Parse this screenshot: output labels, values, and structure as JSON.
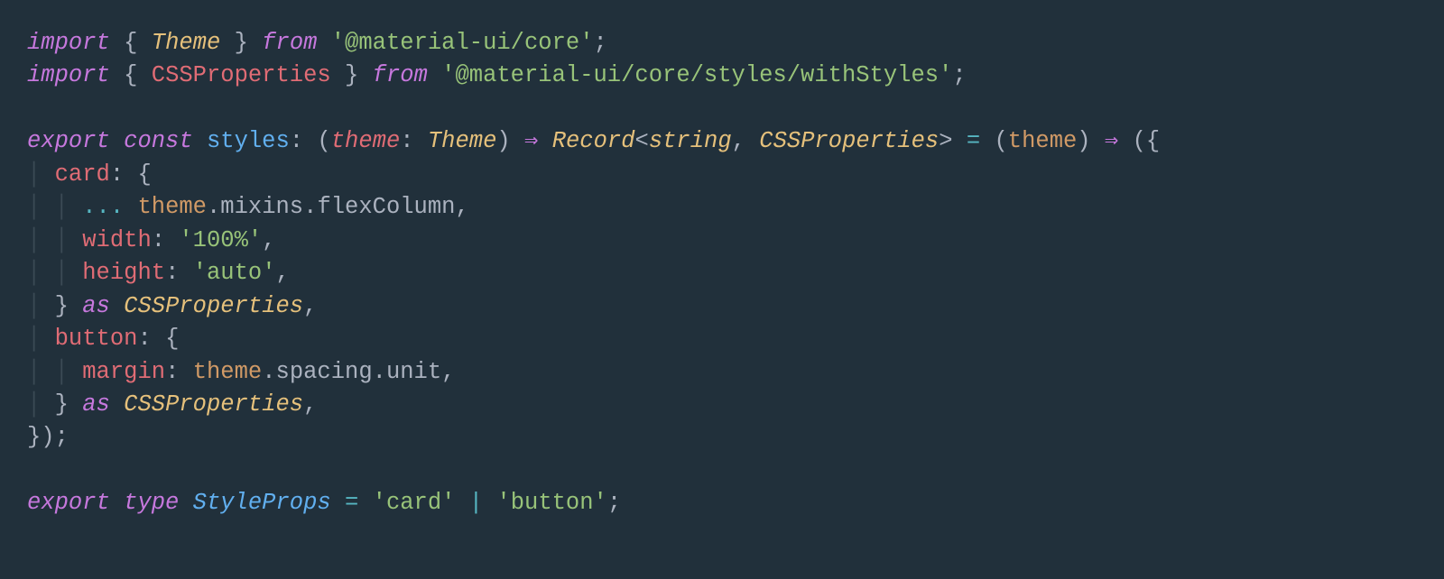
{
  "code": {
    "line1": {
      "import": "import",
      "lbrace": "{",
      "Theme": "Theme",
      "rbrace": "}",
      "from": "from",
      "pkg": "'@material-ui/core'",
      "semi": ";"
    },
    "line2": {
      "import": "import",
      "lbrace": "{",
      "CSSProperties": "CSSProperties",
      "rbrace": "}",
      "from": "from",
      "pkg": "'@material-ui/core/styles/withStyles'",
      "semi": ";"
    },
    "line4": {
      "export": "export",
      "const": "const",
      "styles": "styles",
      "colon": ":",
      "lparen": "(",
      "theme_p": "theme",
      "p_colon": ":",
      "Theme": "Theme",
      "rparen": ")",
      "arrow1": "⇒",
      "Record": "Record",
      "lt": "<",
      "string": "string",
      "comma": ",",
      "CSSProperties": "CSSProperties",
      "gt": ">",
      "eq": "=",
      "lparen2": "(",
      "theme_a": "theme",
      "rparen2": ")",
      "arrow2": "⇒",
      "lparen3": "(",
      "lbrace": "{"
    },
    "line5": {
      "card": "card",
      "colon": ":",
      "lbrace": "{"
    },
    "line6": {
      "spread": "...",
      "theme": "theme",
      "dot1": ".",
      "mixins": "mixins",
      "dot2": ".",
      "flexColumn": "flexColumn",
      "comma": ","
    },
    "line7": {
      "width": "width",
      "colon": ":",
      "val": "'100%'",
      "comma": ","
    },
    "line8": {
      "height": "height",
      "colon": ":",
      "val": "'auto'",
      "comma": ","
    },
    "line9": {
      "rbrace": "}",
      "as": "as",
      "CSSProperties": "CSSProperties",
      "comma": ","
    },
    "line10": {
      "button": "button",
      "colon": ":",
      "lbrace": "{"
    },
    "line11": {
      "margin": "margin",
      "colon": ":",
      "theme": "theme",
      "dot1": ".",
      "spacing": "spacing",
      "dot2": ".",
      "unit": "unit",
      "comma": ","
    },
    "line12": {
      "rbrace": "}",
      "as": "as",
      "CSSProperties": "CSSProperties",
      "comma": ","
    },
    "line13": {
      "rbrace_paren_semi": "});"
    },
    "line15": {
      "export": "export",
      "type": "type",
      "StyleProps": "StyleProps",
      "eq": "=",
      "card": "'card'",
      "pipe": "|",
      "button": "'button'",
      "semi": ";"
    },
    "guides": {
      "g1": "│",
      "g2": "│ │"
    }
  }
}
